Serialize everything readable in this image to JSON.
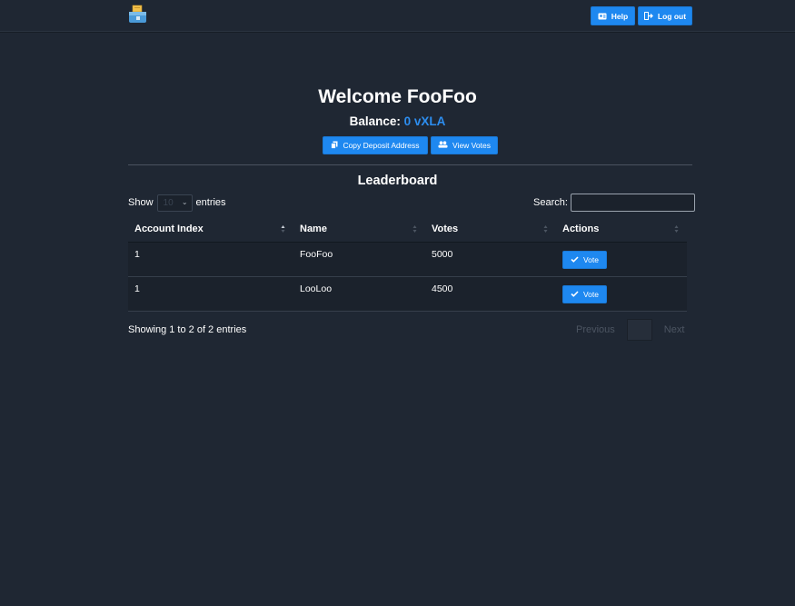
{
  "navbar": {
    "logo_icon": "wallet-logo-icon",
    "help_label": "Help",
    "help_icon": "id-card-icon",
    "logout_label": "Log out",
    "logout_icon": "sign-out-icon"
  },
  "welcome": {
    "title": "Welcome FooFoo",
    "balance_label": "Balance:",
    "balance_value": "0 vXLA"
  },
  "actions": {
    "copy_label": "Copy Deposit Address",
    "copy_icon": "copy-icon",
    "votes_label": "View Votes",
    "votes_icon": "users-icon"
  },
  "leaderboard": {
    "title": "Leaderboard",
    "show_label": "Show",
    "entries_label": "entries",
    "page_length": "10",
    "search_label": "Search:",
    "search_value": "",
    "columns": [
      "Account Index",
      "Name",
      "Votes",
      "Actions"
    ],
    "rows": [
      {
        "account_index": "1",
        "name": "FooFoo",
        "votes": "5000",
        "action": "Vote"
      },
      {
        "account_index": "1",
        "name": "LooLoo",
        "votes": "4500",
        "action": "Vote"
      }
    ],
    "info": "Showing 1 to 2 of 2 entries",
    "previous_label": "Previous",
    "next_label": "Next",
    "current_page": ""
  },
  "colors": {
    "background": "#1f2733",
    "accent": "#1e88f0",
    "balance_value": "#2d8ef0"
  }
}
